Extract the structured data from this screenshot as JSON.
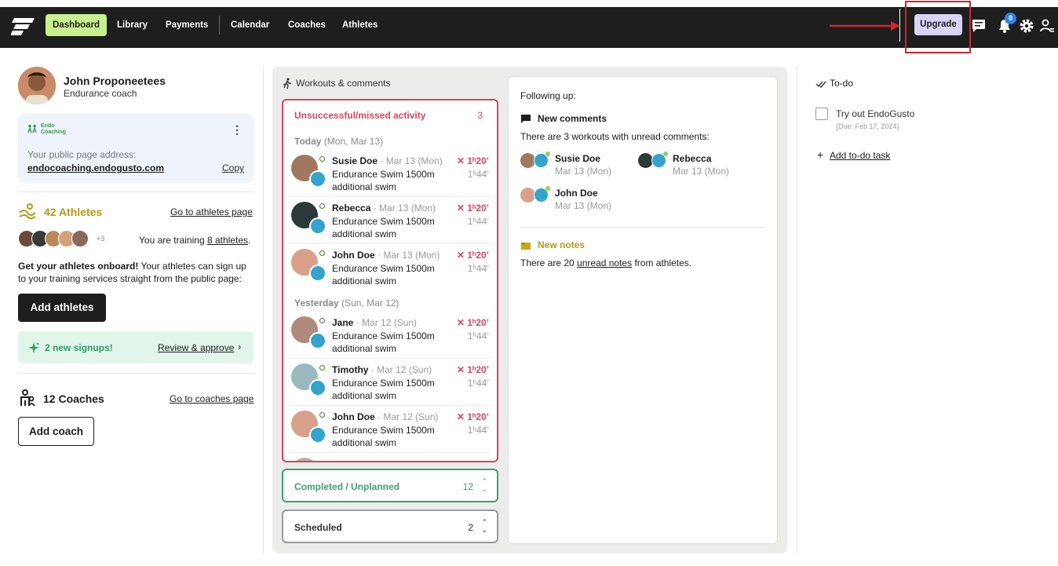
{
  "nav": {
    "items": [
      "Dashboard",
      "Library",
      "Payments",
      "Calendar",
      "Coaches",
      "Athletes"
    ],
    "upgrade_label": "Upgrade",
    "notification_count": "8"
  },
  "profile": {
    "name": "John Proponeetees",
    "role": "Endurance coach"
  },
  "public_page": {
    "brand_line1": "Endo",
    "brand_line2": "Coaching",
    "label": "Your public page address:",
    "url": "endocoaching.endogusto.com",
    "copy_label": "Copy"
  },
  "athletes": {
    "count_label": "42 Athletes",
    "link": "Go to athletes page",
    "extra_count": "+3",
    "training_prefix": "You are training ",
    "training_link": "8 athletes",
    "training_suffix": ".",
    "onboard_bold": "Get your athletes onboard!",
    "onboard_text": " Your athletes can sign up to your training services straight from the public page:",
    "add_button": "Add athletes",
    "signup_text": "2 new signups!",
    "review_link": "Review & approve"
  },
  "coaches": {
    "count_label": "12 Coaches",
    "link": "Go to coaches page",
    "add_button": "Add coach"
  },
  "workouts": {
    "title": "Workouts & comments",
    "missed": {
      "title": "Unsuccessful/missed activity",
      "count": "3",
      "groups": [
        {
          "day": "Today",
          "date": "(Mon, Mar 13)"
        },
        {
          "day": "Yesterday",
          "date": "(Sun, Mar 12)"
        }
      ],
      "items": [
        {
          "name": "Susie Doe",
          "date": " · Mar 13 (Mon)",
          "desc": "Endurance Swim 1500m additional swim",
          "dur": "✕ 1ʰ20’",
          "plan": "1ʰ44’"
        },
        {
          "name": "Rebecca",
          "date": " · Mar 13 (Mon)",
          "desc": "Endurance Swim 1500m additional swim",
          "dur": "✕ 1ʰ20’",
          "plan": "1ʰ44’"
        },
        {
          "name": "John Doe",
          "date": " · Mar 13 (Mon)",
          "desc": "Endurance Swim 1500m additional swim",
          "dur": "✕ 1ʰ20’",
          "plan": "1ʰ44’"
        },
        {
          "name": "Jane",
          "date": " · Mar 12 (Sun)",
          "desc": "Endurance Swim 1500m additional swim",
          "dur": "✕ 1ʰ20’",
          "plan": "1ʰ44’"
        },
        {
          "name": "Timothy",
          "date": " · Mar 12 (Sun)",
          "desc": "Endurance Swim 1500m additional swim",
          "dur": "✕ 1ʰ20’",
          "plan": "1ʰ44’"
        },
        {
          "name": "John Doe",
          "date": " · Mar 12 (Sun)",
          "desc": "Endurance Swim 1500m additional swim",
          "dur": "✕ 1ʰ20’",
          "plan": "1ʰ44’"
        }
      ]
    },
    "completed": {
      "title": "Completed / Unplanned",
      "count": "12"
    },
    "scheduled": {
      "title": "Scheduled",
      "count": "2"
    }
  },
  "following": {
    "title": "Following up:",
    "comments_head": "New comments",
    "comments_text": "There are 3 workouts with unread comments:",
    "commenters": [
      {
        "name": "Susie Doe",
        "date": "Mar 13 (Mon)"
      },
      {
        "name": "Rebecca",
        "date": "Mar 13 (Mon)"
      },
      {
        "name": "John Doe",
        "date": "Mar 13 (Mon)"
      }
    ],
    "notes_head": "New notes",
    "notes_prefix": "There are 20 ",
    "notes_link": "unread notes",
    "notes_suffix": " from athletes."
  },
  "todo": {
    "title": "To-do",
    "item": "Try out EndoGusto",
    "due": "(Due: Feb 17, 2024)",
    "add_link": "Add to-do task"
  },
  "colors": {
    "nav_bg": "#1e1e1e",
    "active_nav": "#c9f08f",
    "upgrade_bg": "#d9d4f7",
    "missed_red": "#d9455c",
    "completed_green": "#3aa172",
    "athletes_gold": "#b59a12",
    "highlight_red": "#d0232a"
  }
}
